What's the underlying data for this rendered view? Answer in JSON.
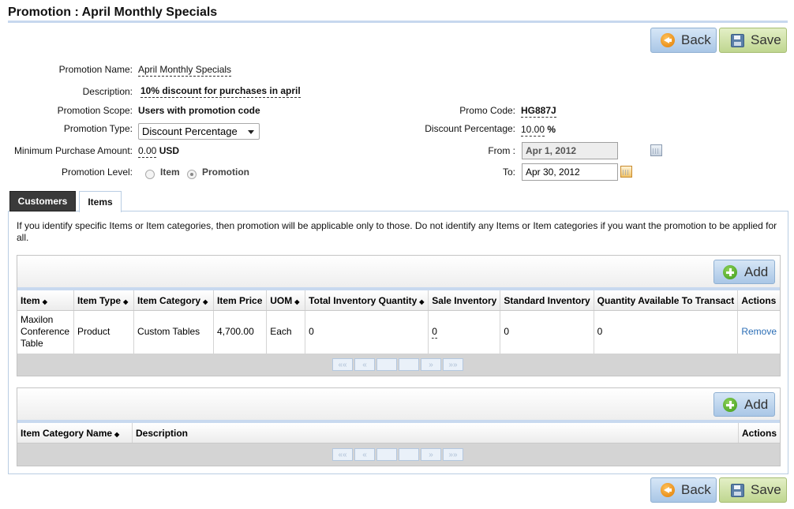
{
  "page": {
    "title": "Promotion : April Monthly Specials"
  },
  "buttons": {
    "back": "Back",
    "save": "Save",
    "add": "Add"
  },
  "form": {
    "name": {
      "label": "Promotion Name:",
      "value": "April Monthly Specials"
    },
    "description": {
      "label": "Description:",
      "value": "10% discount for purchases in april"
    },
    "scope": {
      "label": "Promotion Scope:",
      "value": "Users with promotion code"
    },
    "type": {
      "label": "Promotion Type:",
      "value": "Discount Percentage"
    },
    "min_purchase": {
      "label": "Minimum Purchase Amount:",
      "value": "0.00",
      "unit": "USD"
    },
    "level": {
      "label": "Promotion Level:",
      "options": [
        "Item",
        "Promotion"
      ],
      "selected": "Promotion"
    },
    "promo_code": {
      "label": "Promo Code:",
      "value": "HG887J"
    },
    "discount": {
      "label": "Discount Percentage:",
      "value": "10.00",
      "unit": "%"
    },
    "from": {
      "label": "From :",
      "value": "Apr 1, 2012"
    },
    "to": {
      "label": "To:",
      "value": "Apr 30, 2012"
    }
  },
  "tabs": [
    {
      "label": "Customers"
    },
    {
      "label": "Items"
    }
  ],
  "info_text": "If you identify specific Items or Item categories, then promotion will be applicable only to those. Do not identify any Items or Item categories if you want the promotion to be applied for all.",
  "items_table": {
    "columns": [
      "Item",
      "Item Type",
      "Item Category",
      "Item Price",
      "UOM",
      "Total Inventory Quantity",
      "Sale Inventory",
      "Standard Inventory",
      "Quantity Available To Transact",
      "Actions"
    ],
    "rows": [
      {
        "item": "Maxilon Conference Table",
        "type": "Product",
        "category": "Custom Tables",
        "price": "4,700.00",
        "uom": "Each",
        "total_inv": "0",
        "sale_inv": "0",
        "std_inv": "0",
        "qty_avail": "0",
        "action": "Remove"
      }
    ]
  },
  "category_table": {
    "columns": [
      "Item Category Name",
      "Description",
      "Actions"
    ]
  },
  "pager": {
    "first": "««",
    "prev": "«",
    "next": "»",
    "last": "»»"
  },
  "colors": {
    "accent_rule": "#c7d8ee",
    "active_tab": "#3a3a3a",
    "link": "#2a6db5"
  }
}
